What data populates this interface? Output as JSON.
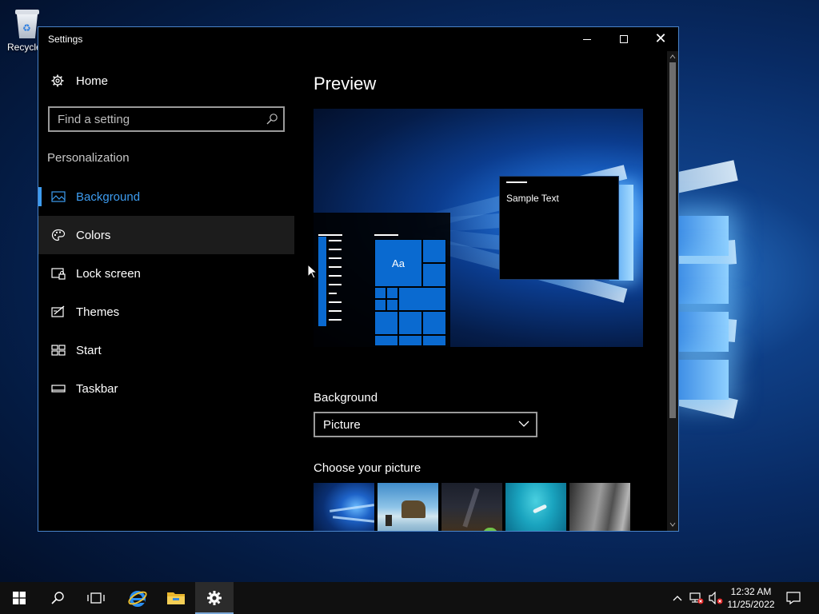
{
  "desktop": {
    "recycle_bin_label": "Recycle"
  },
  "window": {
    "title": "Settings",
    "controls": {
      "minimize": "minimize",
      "maximize": "maximize",
      "close": "close"
    }
  },
  "nav": {
    "home_label": "Home",
    "search_placeholder": "Find a setting",
    "section_label": "Personalization",
    "items": [
      {
        "label": "Background",
        "icon": "picture-icon",
        "active": true
      },
      {
        "label": "Colors",
        "icon": "palette-icon",
        "active": false
      },
      {
        "label": "Lock screen",
        "icon": "lock-screen-icon",
        "active": false
      },
      {
        "label": "Themes",
        "icon": "themes-icon",
        "active": false
      },
      {
        "label": "Start",
        "icon": "start-icon",
        "active": false
      },
      {
        "label": "Taskbar",
        "icon": "taskbar-icon",
        "active": false
      }
    ]
  },
  "content": {
    "preview_heading": "Preview",
    "preview": {
      "tile_label": "Aa",
      "sample_text": "Sample Text"
    },
    "background_label": "Background",
    "background_value": "Picture",
    "choose_picture_label": "Choose your picture",
    "pictures": [
      {
        "name": "windows-light-wallpaper"
      },
      {
        "name": "beach-rock-wallpaper"
      },
      {
        "name": "night-sky-tent-wallpaper"
      },
      {
        "name": "underwater-swimmer-wallpaper"
      },
      {
        "name": "rock-cliff-wallpaper"
      }
    ]
  },
  "taskbar": {
    "icons": [
      "start-icon",
      "search-icon",
      "task-view-icon",
      "internet-explorer-icon",
      "file-explorer-icon",
      "settings-icon"
    ],
    "active_app": "settings-icon",
    "tray": [
      "chevron-up-icon",
      "network-icon",
      "volume-muted-icon"
    ],
    "time": "12:32 AM",
    "date": "11/25/2022",
    "notifications": "action-center-icon"
  },
  "colors": {
    "accent": "#3d9cf0",
    "tile_blue": "#0a6ad0",
    "window_bg": "#000000",
    "window_border": "#4a84c9",
    "taskbar_bg": "#101010"
  }
}
